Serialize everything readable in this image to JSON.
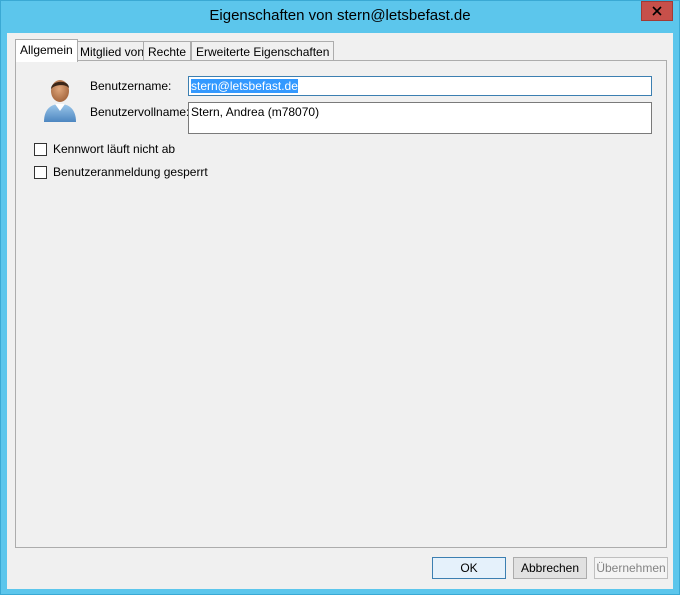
{
  "window": {
    "title": "Eigenschaften von stern@letsbefast.de",
    "close_icon": "close-icon"
  },
  "tabs": [
    {
      "label": "Allgemein",
      "active": true
    },
    {
      "label": "Mitglied von",
      "active": false
    },
    {
      "label": "Rechte",
      "active": false
    },
    {
      "label": "Erweiterte Eigenschaften",
      "active": false
    }
  ],
  "general": {
    "avatar_icon": "user-avatar-icon",
    "username_label": "Benutzername:",
    "username_value": "stern@letsbefast.de",
    "fullname_label": "Benutzervollname:",
    "fullname_value": "Stern, Andrea (m78070)",
    "checkbox_password_never_expires": {
      "label": "Kennwort läuft nicht ab",
      "checked": false
    },
    "checkbox_login_disabled": {
      "label": "Benutzeranmeldung gesperrt",
      "checked": false
    }
  },
  "buttons": {
    "ok": "OK",
    "cancel": "Abbrechen",
    "apply": "Übernehmen"
  }
}
